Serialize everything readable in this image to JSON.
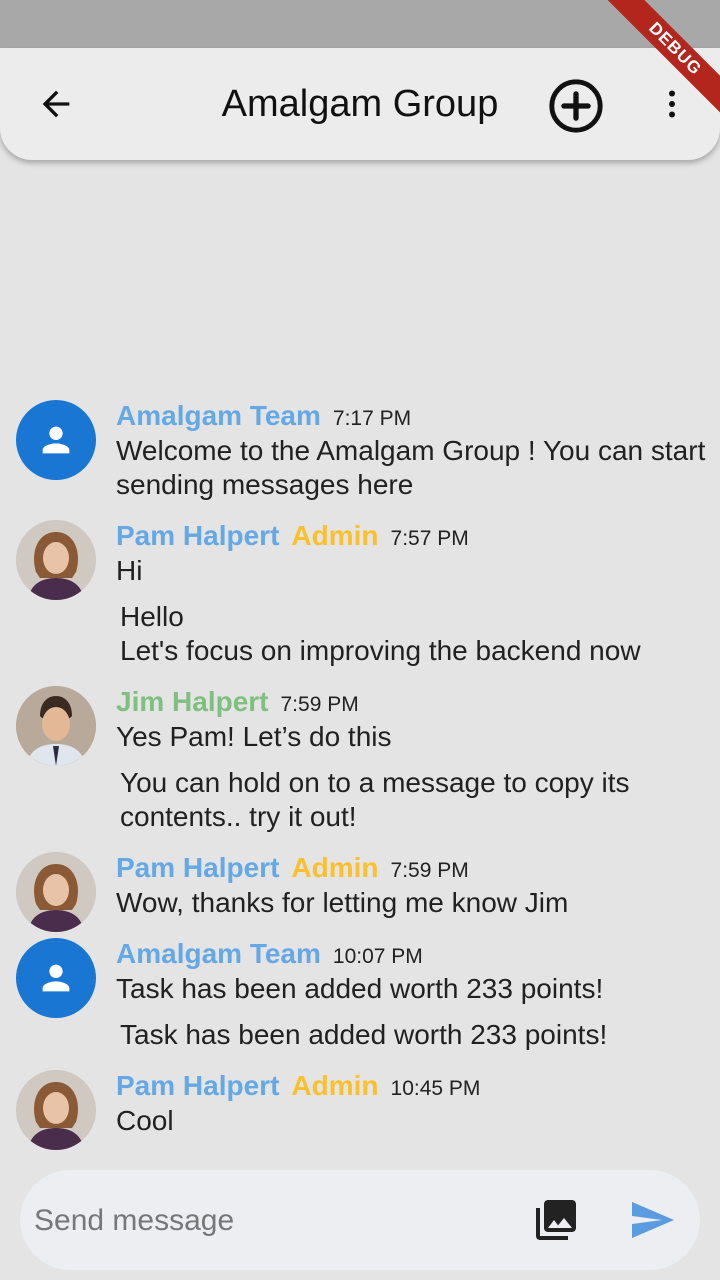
{
  "app_bar": {
    "title": "Amalgam Group",
    "back_icon": "arrow-back-icon",
    "add_icon": "add-circle-icon",
    "more_icon": "more-vert-icon"
  },
  "debug_banner": "DEBUG",
  "colors": {
    "team_avatar": "#1976d2",
    "sender_name": "#64a8e6",
    "jim_name": "#7fbf7f",
    "admin_badge": "#fbc02d",
    "send_icon": "#5b9be0"
  },
  "messages": [
    {
      "sender": "Amalgam Team",
      "role": "",
      "time": "7:17 PM",
      "avatar": "person-icon",
      "text": "Welcome to the Amalgam Group ! You can start sending messages here",
      "followups": []
    },
    {
      "sender": "Pam Halpert",
      "role": "Admin",
      "time": "7:57 PM",
      "avatar": "pam-photo",
      "text": "Hi",
      "followups": [
        "Hello\nLet's focus on improving the backend now"
      ]
    },
    {
      "sender": "Jim Halpert",
      "role": "",
      "time": "7:59 PM",
      "avatar": "jim-photo",
      "text": "Yes Pam! Let’s do this",
      "followups": [
        "You can hold on to a message to copy its contents.. try it out!"
      ]
    },
    {
      "sender": "Pam Halpert",
      "role": "Admin",
      "time": "7:59 PM",
      "avatar": "pam-photo",
      "text": "Wow, thanks for letting me know Jim",
      "followups": []
    },
    {
      "sender": "Amalgam Team",
      "role": "",
      "time": "10:07 PM",
      "avatar": "person-icon",
      "text": "Task has been added worth 233 points!",
      "followups": [
        "Task has been added worth 233 points!"
      ]
    },
    {
      "sender": "Pam Halpert",
      "role": "Admin",
      "time": "10:45 PM",
      "avatar": "pam-photo",
      "text": "Cool",
      "followups": []
    }
  ],
  "composer": {
    "placeholder": "Send message",
    "value": "",
    "attach_icon": "photo-library-icon",
    "send_icon": "send-icon"
  }
}
